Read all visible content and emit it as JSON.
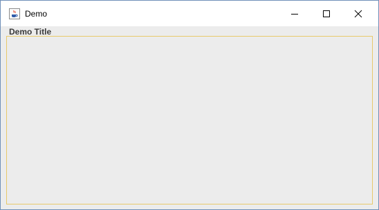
{
  "window": {
    "title": "Demo",
    "icons": {
      "app": "java-cup-icon",
      "minimize": "minimize-icon",
      "maximize": "maximize-icon",
      "close": "close-icon"
    }
  },
  "content": {
    "panel_title": "Demo Title"
  },
  "colors": {
    "window_border": "#6f8fb8",
    "client_background": "#ececec",
    "panel_border": "#e8c96a",
    "titlebar_background": "#ffffff"
  }
}
